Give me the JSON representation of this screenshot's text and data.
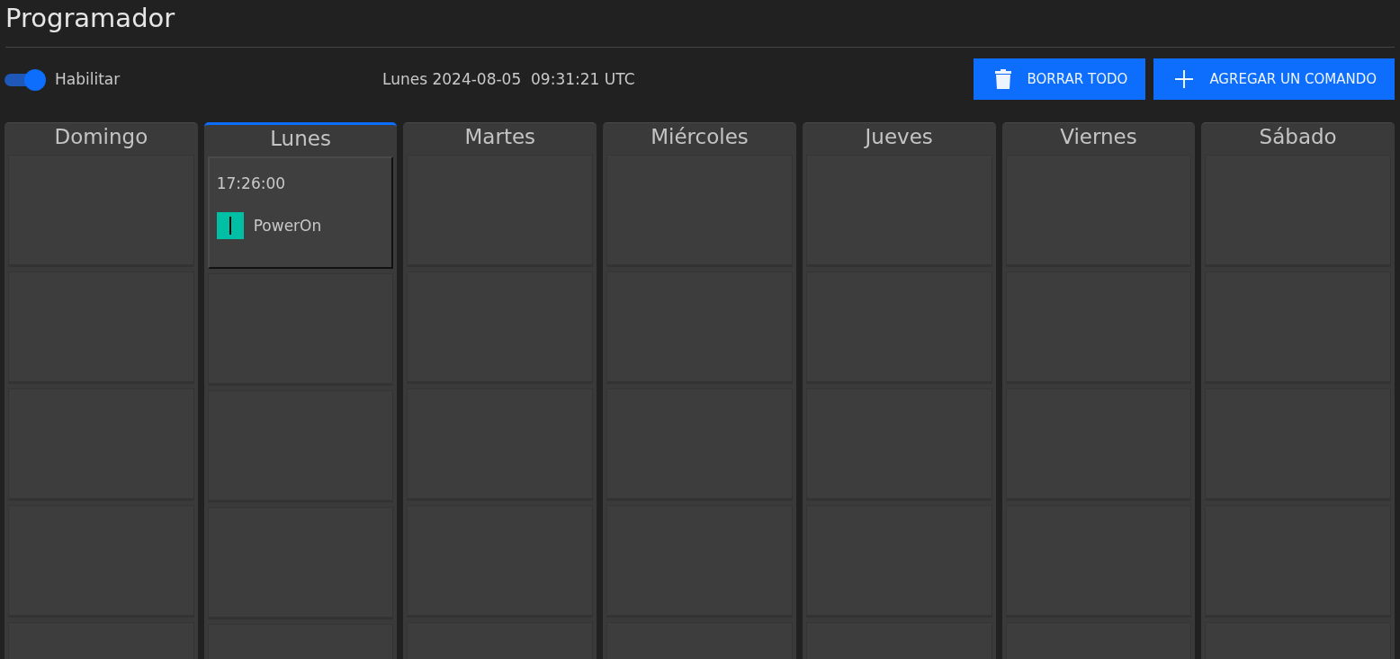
{
  "title": "Programador",
  "enable": {
    "label": "Habilitar",
    "on": true
  },
  "clock": "Lunes 2024-08-05  09:31:21 UTC",
  "buttons": [
    {
      "kind": "delete",
      "label": "BORRAR TODO"
    },
    {
      "kind": "add",
      "label": "AGREGAR UN COMANDO"
    }
  ],
  "days": [
    {
      "name": "Domingo",
      "selected": false
    },
    {
      "name": "Lunes",
      "selected": true,
      "commands": [
        {
          "time": "17:26:00",
          "action": "PowerOn"
        }
      ]
    },
    {
      "name": "Martes",
      "selected": false
    },
    {
      "name": "Miércoles",
      "selected": false
    },
    {
      "name": "Jueves",
      "selected": false
    },
    {
      "name": "Viernes",
      "selected": false
    },
    {
      "name": "Sábado",
      "selected": false
    }
  ]
}
